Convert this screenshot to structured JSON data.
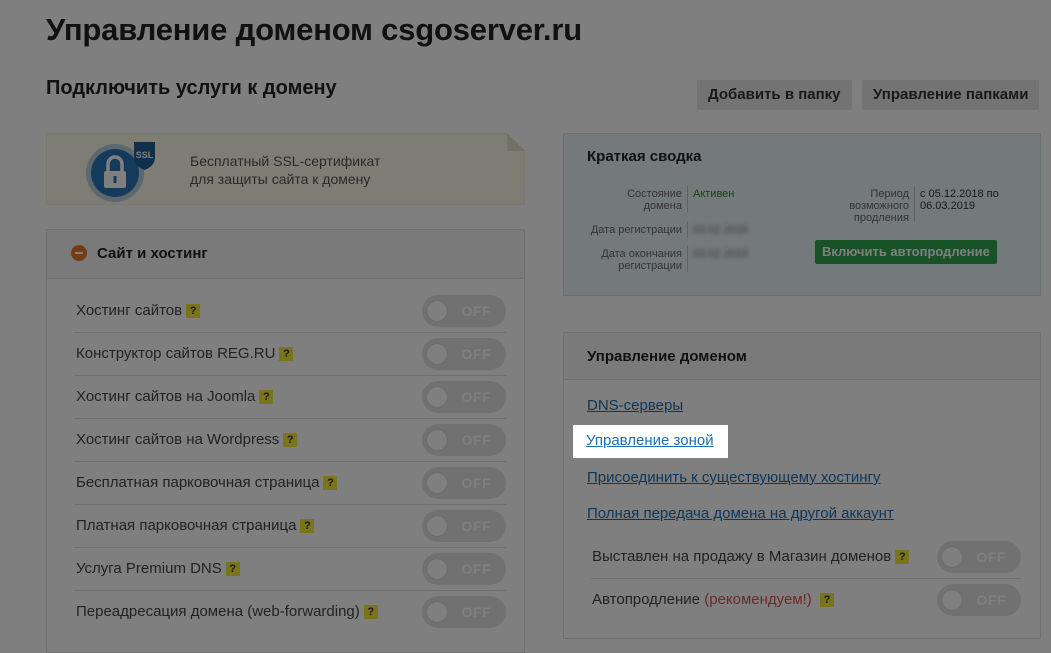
{
  "page": {
    "title": "Управление доменом csgoserver.ru",
    "subtitle": "Подключить услуги к домену"
  },
  "toolbar": {
    "add_to_folder": "Добавить в папку",
    "manage_folders": "Управление папками"
  },
  "ssl_banner": {
    "badge": "SSL",
    "line1": "Бесплатный SSL-сертификат",
    "line2": "для защиты сайта к домену"
  },
  "hosting_section": {
    "title": "Сайт и хостинг",
    "help": "?",
    "toggle_off": "OFF",
    "services": [
      {
        "label": "Хостинг сайтов"
      },
      {
        "label": "Конструктор сайтов REG.RU"
      },
      {
        "label": "Хостинг сайтов на Joomla"
      },
      {
        "label": "Хостинг сайтов на Wordpress"
      },
      {
        "label": "Бесплатная парковочная страница"
      },
      {
        "label": "Платная парковочная страница"
      },
      {
        "label": "Услуга Premium DNS"
      },
      {
        "label": "Переадресация домена (web-forwarding)"
      }
    ]
  },
  "summary": {
    "title": "Краткая сводка",
    "status_label_1": "Состояние",
    "status_label_2": "домена",
    "status_value": "Активен",
    "reg_label": "Дата регистрации",
    "reg_value": "03.02.2018",
    "exp_label_1": "Дата окончания",
    "exp_label_2": "регистрации",
    "exp_value": "03.02.2019",
    "renew_label_1": "Период",
    "renew_label_2": "возможного",
    "renew_label_3": "продления",
    "renew_value_1": "с 05.12.2018 по",
    "renew_value_2": "06.03.2019",
    "autorenew_button": "Включить автопродление"
  },
  "domain_management": {
    "title": "Управление доменом",
    "links": {
      "dns": "DNS-серверы",
      "zone": "Управление зоной",
      "attach": "Присоединить к существующему хостингу",
      "transfer": "Полная передача домена на другой аккаунт"
    },
    "for_sale_label": "Выставлен на продажу в Магазин доменов",
    "autorenew_label": "Автопродление",
    "recommended": "(рекомендуем!)",
    "toggle_off": "OFF",
    "help": "?"
  },
  "colors": {
    "accent_green": "#2ea74f",
    "link_blue": "#1a6fb5",
    "warning_red": "#d9534f",
    "help_yellow": "#f4ea3a",
    "orange": "#e8792a"
  }
}
